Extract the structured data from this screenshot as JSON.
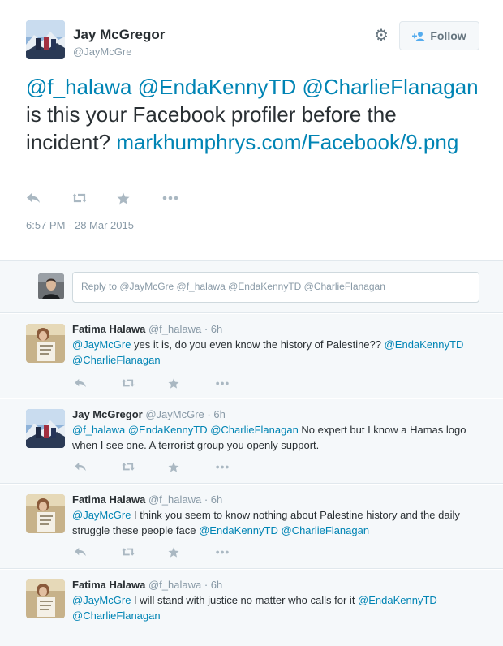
{
  "main_tweet": {
    "name": "Jay McGregor",
    "handle": "@JayMcGre",
    "follow_label": "Follow",
    "text_mentions": "@f_halawa @EndaKennyTD @CharlieFlanagan",
    "mention_1": "@f_halawa",
    "mention_2": "@EndaKennyTD",
    "mention_3": "@CharlieFlanagan",
    "text_body": " is this your Facebook profiler before the incident? ",
    "link": "markhumphrys.com/Facebook/9.png",
    "timestamp": "6:57 PM - 28 Mar 2015",
    "icons": [
      "reply-icon",
      "retweet-icon",
      "favorite-icon",
      "more-icon",
      "gear-icon",
      "follow-person-icon"
    ]
  },
  "reply_box": {
    "placeholder": "Reply to @JayMcGre @f_halawa @EndaKennyTD @CharlieFlanagan"
  },
  "replies": [
    {
      "name": "Fatima Halawa",
      "handle": "@f_halawa",
      "time": "6h",
      "seg1": "@JayMcGre",
      "seg2": " yes it is, do you even know the history of Palestine?? ",
      "seg3": "@EndaKennyTD",
      "seg4": " ",
      "seg5": "@CharlieFlanagan",
      "seg6": ""
    },
    {
      "name": "Jay McGregor",
      "handle": "@JayMcGre",
      "time": "6h",
      "seg1": "@f_halawa @EndaKennyTD @CharlieFlanagan",
      "seg2": " No expert but I know a Hamas logo when I see one. A terrorist group you openly support.",
      "seg3": "",
      "seg4": "",
      "seg5": "",
      "seg6": ""
    },
    {
      "name": "Fatima Halawa",
      "handle": "@f_halawa",
      "time": "6h",
      "seg1": "@JayMcGre",
      "seg2": " I think you seem to know nothing about Palestine history and the daily struggle these people face ",
      "seg3": "@EndaKennyTD",
      "seg4": " ",
      "seg5": "@CharlieFlanagan",
      "seg6": ""
    },
    {
      "name": "Fatima Halawa",
      "handle": "@f_halawa",
      "time": "6h",
      "seg1": "@JayMcGre",
      "seg2": " I will stand with justice no matter who calls for it ",
      "seg3": "@EndaKennyTD",
      "seg4": " ",
      "seg5": "@CharlieFlanagan",
      "seg6": ""
    }
  ],
  "separator": "·",
  "colors": {
    "link": "#0084b4",
    "meta": "#8899a6",
    "icon": "#aab8c2",
    "reply_bg": "#f5f8fa"
  }
}
